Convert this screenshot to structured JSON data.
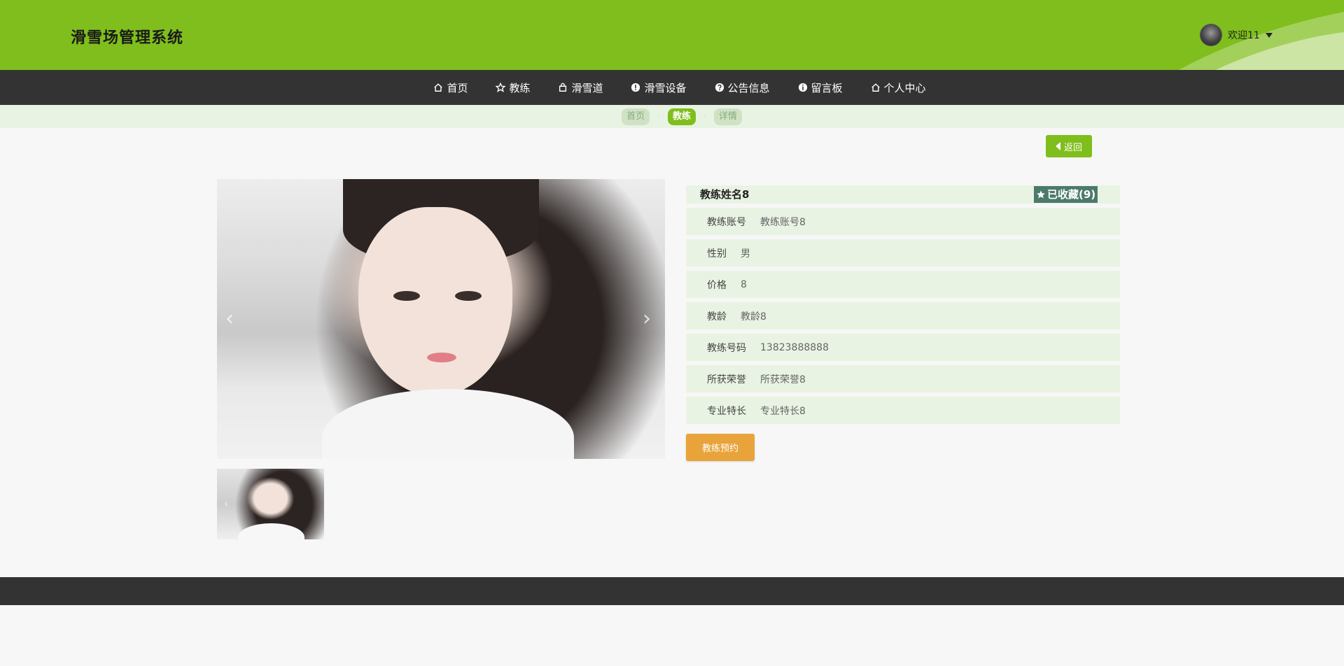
{
  "header": {
    "site_title": "滑雪场管理系统",
    "welcome": "欢迎11"
  },
  "nav": {
    "items": [
      {
        "label": "首页",
        "icon": "home-icon"
      },
      {
        "label": "教练",
        "icon": "star-icon"
      },
      {
        "label": "滑雪道",
        "icon": "bag-icon"
      },
      {
        "label": "滑雪设备",
        "icon": "exclamation-icon"
      },
      {
        "label": "公告信息",
        "icon": "question-icon"
      },
      {
        "label": "留言板",
        "icon": "info-icon"
      },
      {
        "label": "个人中心",
        "icon": "home-icon"
      }
    ]
  },
  "breadcrumb": {
    "items": [
      "首页",
      "教练",
      "详情"
    ],
    "active_index": 1
  },
  "back_label": "返回",
  "detail": {
    "name": "教练姓名8",
    "favorite_label": "已收藏(9)",
    "rows": [
      {
        "label": "教练账号",
        "value": "教练账号8"
      },
      {
        "label": "性别",
        "value": "男"
      },
      {
        "label": "价格",
        "value": "8"
      },
      {
        "label": "教龄",
        "value": "教龄8"
      },
      {
        "label": "教练号码",
        "value": "13823888888"
      },
      {
        "label": "所获荣誉",
        "value": "所获荣誉8"
      },
      {
        "label": "专业特长",
        "value": "专业特长8"
      }
    ],
    "book_label": "教练预约"
  },
  "colors": {
    "brand_green": "#7fbe1c",
    "nav_dark": "#333333",
    "crumb_bg": "#e9f3e3",
    "favorite_bg": "#4c7a6a",
    "book_orange": "#e8a43a"
  }
}
